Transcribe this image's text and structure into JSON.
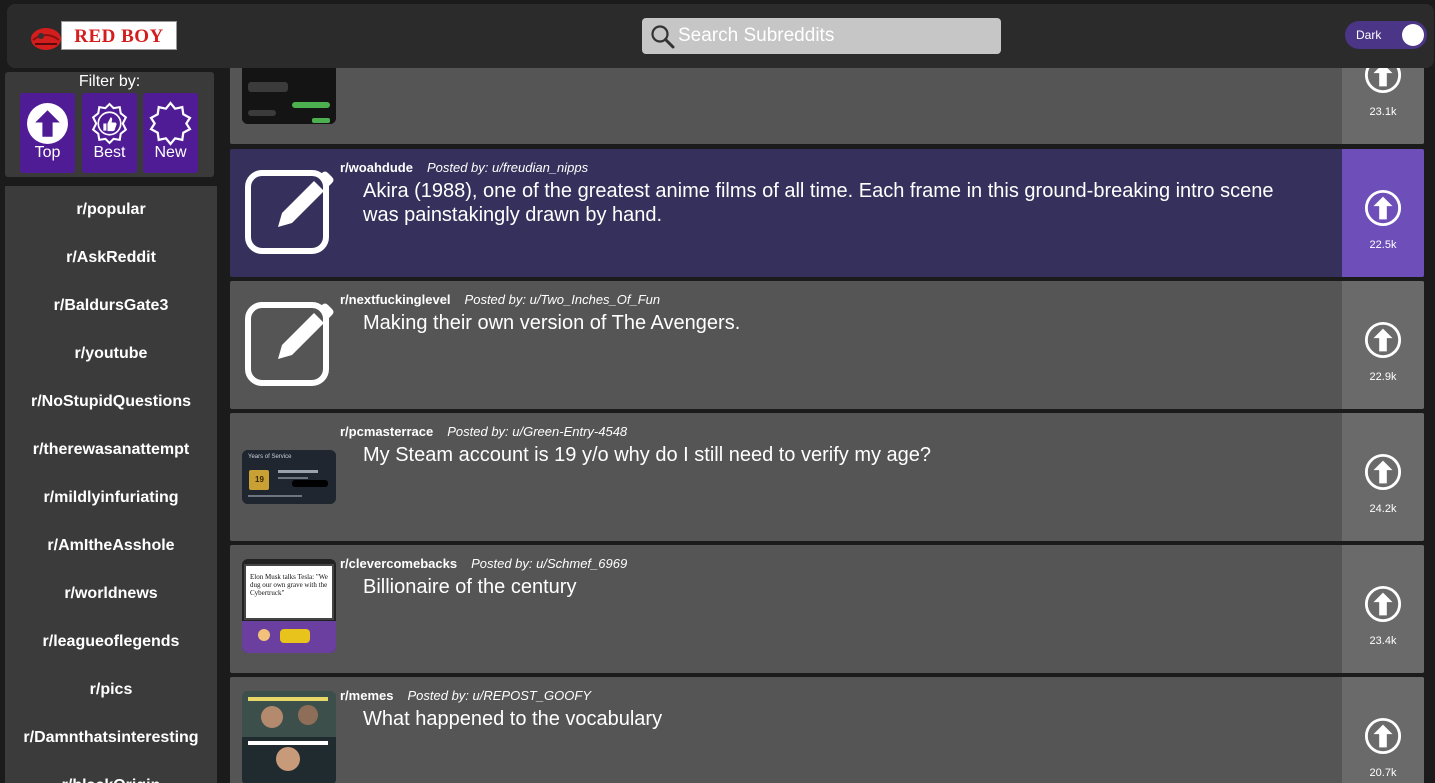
{
  "header": {
    "logo_text": "RED BOY",
    "search_placeholder": "Search Subreddits",
    "theme_toggle_label": "Dark"
  },
  "filter": {
    "title": "Filter by:",
    "buttons": [
      {
        "label": "Top",
        "icon": "arrow-up-circle-icon"
      },
      {
        "label": "Best",
        "icon": "badge-thumbs-up-icon"
      },
      {
        "label": "New",
        "icon": "starburst-badge-icon"
      }
    ]
  },
  "sidebar": {
    "items": [
      "r/popular",
      "r/AskReddit",
      "r/BaldursGate3",
      "r/youtube",
      "r/NoStupidQuestions",
      "r/therewasanattempt",
      "r/mildlyinfuriating",
      "r/AmItheAsshole",
      "r/worldnews",
      "r/leagueoflegends",
      "r/pics",
      "r/Damnthatsinteresting",
      "r/blackOrigin"
    ]
  },
  "posts": [
    {
      "subreddit": "",
      "poster": "",
      "title": "",
      "votes": "23.1k",
      "thumb": "chat-screenshot"
    },
    {
      "subreddit": "r/woahdude",
      "poster": "Posted by: u/freudian_nipps",
      "title": "Akira (1988), one of the greatest anime films of all time. Each frame in this ground-breaking intro scene was painstakingly drawn by hand.",
      "votes": "22.5k",
      "thumb": "edit-icon"
    },
    {
      "subreddit": "r/nextfuckinglevel",
      "poster": "Posted by: u/Two_Inches_Of_Fun",
      "title": "Making their own version of The Avengers.",
      "votes": "22.9k",
      "thumb": "edit-icon"
    },
    {
      "subreddit": "r/pcmasterrace",
      "poster": "Posted by: u/Green-Entry-4548",
      "title": "My Steam account is 19 y/o why do I still need to verify my age?",
      "votes": "24.2k",
      "thumb": "steam-badge"
    },
    {
      "subreddit": "r/clevercomebacks",
      "poster": "Posted by: u/Schmef_6969",
      "title": "Billionaire of the century",
      "votes": "23.4k",
      "thumb": "news-screenshot"
    },
    {
      "subreddit": "r/memes",
      "poster": "Posted by: u/REPOST_GOOFY",
      "title": "What happened to the vocabulary",
      "votes": "20.7k",
      "thumb": "meme-photo"
    }
  ],
  "thumb_text": {
    "steam_heading": "Years of Service",
    "steam_badge_number": "19",
    "news_headline": "Elon Musk talks Tesla: \"We dug our own grave with the Cybertruck\""
  },
  "colors": {
    "accent_purple": "#501c95",
    "active_post": "#36315c",
    "active_vote": "#6e4fb9",
    "logo_red": "#d41e1e"
  }
}
